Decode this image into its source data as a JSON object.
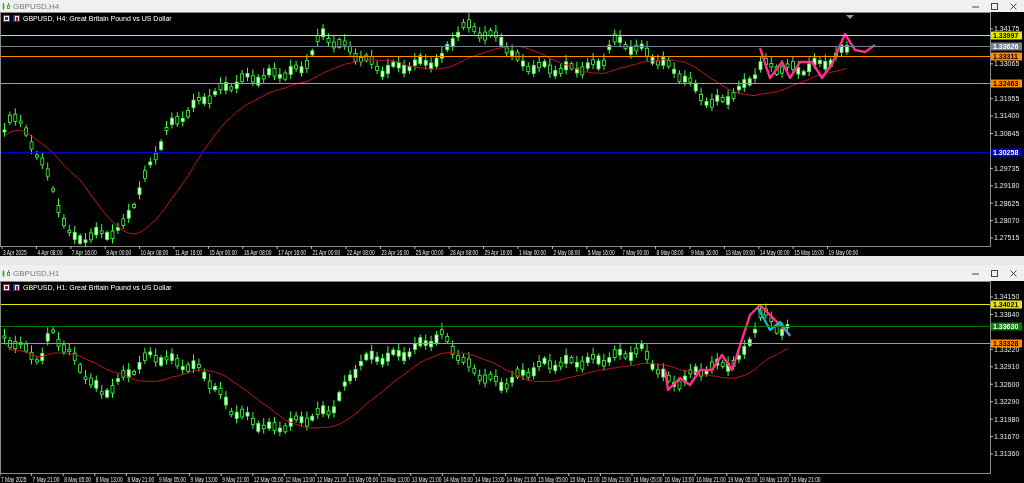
{
  "windows": [
    {
      "title": "GBPUSD,H4",
      "chart": {
        "caption": "GBPUSD, H4: Great Britain Pound vs US Dollar",
        "price_ticks": [
          "1.34175",
          "1.33065",
          "1.31955",
          "1.31400",
          "1.30845",
          "1.29735",
          "1.29180",
          "1.28625",
          "1.28070",
          "1.27515"
        ],
        "price_lines": [
          {
            "tag": "1.33997",
            "color": "#e6e600"
          },
          {
            "tag": "1.33626",
            "color": "#708090"
          },
          {
            "tag": "1.33311",
            "color": "#ff8c00"
          },
          {
            "tag": "1.32463",
            "color": "#ff8c00"
          },
          {
            "tag": "1.30258",
            "color": "#0000cd"
          }
        ],
        "time_ticks": [
          "3 Apr 2025",
          "4 Apr 08:00",
          "7 Apr 16:00",
          "9 Apr 00:00",
          "10 Apr 08:00",
          "11 Apr 16:00",
          "15 Apr 00:00",
          "16 Apr 08:00",
          "17 Apr 16:00",
          "21 Apr 00:00",
          "22 Apr 08:00",
          "23 Apr 16:00",
          "25 Apr 00:00",
          "28 Apr 08:00",
          "29 Apr 16:00",
          "1 May 00:00",
          "2 May 08:00",
          "5 May 16:00",
          "7 May 00:00",
          "8 May 08:00",
          "9 May 16:00",
          "13 May 00:00",
          "14 May 00:00",
          "15 May 16:00",
          "19 May 00:00"
        ]
      }
    },
    {
      "title": "GBPUSD,H1",
      "chart": {
        "caption": "GBPUSD, H1: Great Britain Pound vs US Dollar",
        "price_ticks": [
          "1.34150",
          "1.33840",
          "1.33220",
          "1.32910",
          "1.32600",
          "1.32290",
          "1.31980",
          "1.31670",
          "1.31360"
        ],
        "price_lines": [
          {
            "tag": "1.34021",
            "color": "#e6e600"
          },
          {
            "tag": "1.33630",
            "color": "#008000"
          },
          {
            "tag": "1.33328",
            "color": "#ff8c00"
          }
        ],
        "time_ticks": [
          "7 May 2025",
          "7 May 21:00",
          "8 May 05:00",
          "8 May 13:00",
          "8 May 21:00",
          "9 May 05:00",
          "9 May 13:00",
          "9 May 21:00",
          "12 May 05:00",
          "12 May 13:00",
          "12 May 21:00",
          "13 May 05:00",
          "13 May 13:00",
          "13 May 21:00",
          "14 May 05:00",
          "14 May 13:00",
          "14 May 21:00",
          "15 May 05:00",
          "15 May 13:00",
          "15 May 21:00",
          "16 May 05:00",
          "16 May 13:00",
          "16 May 21:00",
          "19 May 05:00",
          "19 May 13:00",
          "19 May 21:00"
        ]
      }
    }
  ]
}
